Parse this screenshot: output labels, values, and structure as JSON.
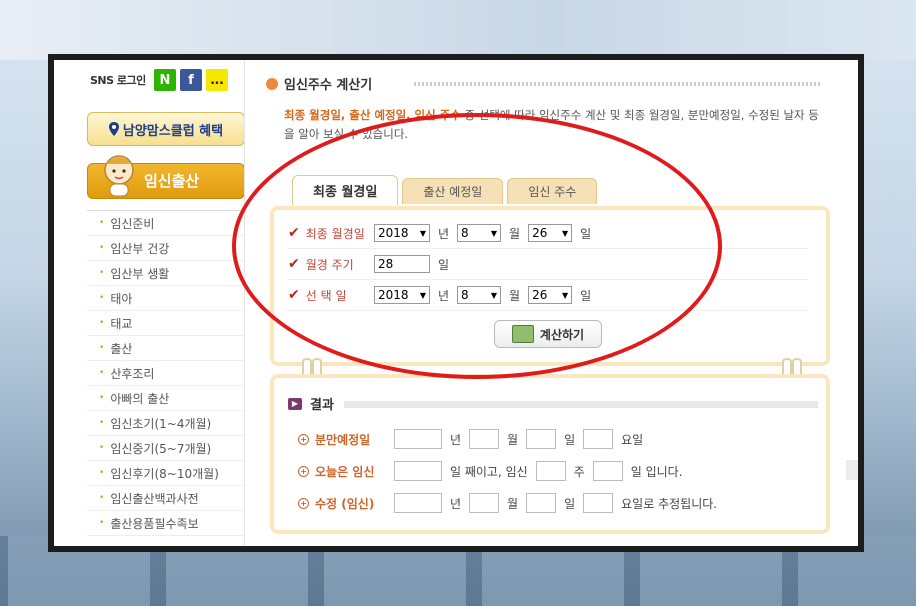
{
  "sidebar": {
    "sns_label": "SNS 로그인",
    "sns_icons": [
      "N",
      "f",
      "..."
    ],
    "benefit_label": "남양맘스클럽 혜택",
    "pregnancy_label": "임신출산",
    "items": [
      "임신준비",
      "임산부 건강",
      "임산부 생활",
      "태아",
      "태교",
      "출산",
      "산후조리",
      "아빠의 출산",
      "임신초기(1~4개월)",
      "임신중기(5~7개월)",
      "임신후기(8~10개월)",
      "임신출산백과사전",
      "출산용품필수족보"
    ]
  },
  "main": {
    "title": "임신주수 계산기",
    "desc_hl": "최종 월경일, 출산 예정일, 임신 주수",
    "desc_rest": " 중 선택에 따라 임신주수 계산 및 최종 월경일, 분만예정일, 수정된 날자 등을 알아 보실 수 있습니다.",
    "tabs": [
      "최종 월경일",
      "출산 예정일",
      "임신 주수"
    ],
    "form": {
      "row1": {
        "label": "최종 월경일",
        "year": "2018",
        "month": "8",
        "day": "26"
      },
      "row2": {
        "label": "월경 주기",
        "value": "28",
        "unit": "일"
      },
      "row3": {
        "label": "선 택 일",
        "year": "2018",
        "month": "8",
        "day": "26"
      },
      "unit_year": "년",
      "unit_month": "월",
      "unit_day": "일",
      "calc_button": "계산하기"
    },
    "result": {
      "title": "결과",
      "row1_label": "분만예정일",
      "row1_units": [
        "년",
        "월",
        "일",
        "요일"
      ],
      "row2_label": "오늘은 임신",
      "row2_text1": "일 째이고, 임신",
      "row2_text2": "주",
      "row2_text3": "일 입니다.",
      "row3_label": "수정 (임신)",
      "row3_units": [
        "년",
        "월",
        "일",
        "요일로 추정됩니다."
      ]
    }
  },
  "colors": {
    "accent_orange": "#d76a1a",
    "annotation_red": "#e01b1b",
    "tab_bg": "#f5e1b5"
  }
}
